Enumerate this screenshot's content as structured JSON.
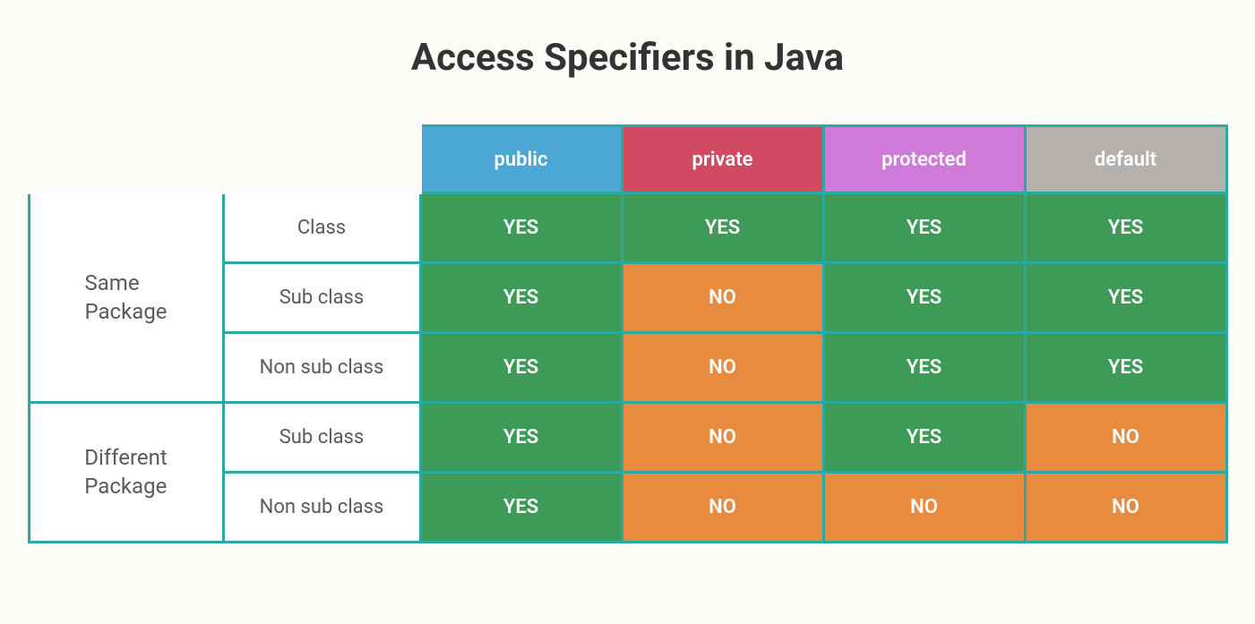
{
  "title": "Access Specifiers in Java",
  "columns": [
    "public",
    "private",
    "protected",
    "default"
  ],
  "groups": [
    {
      "name": "Same\nPackage",
      "rows": [
        {
          "label": "Class",
          "values": [
            "YES",
            "YES",
            "YES",
            "YES"
          ]
        },
        {
          "label": "Sub class",
          "values": [
            "YES",
            "NO",
            "YES",
            "YES"
          ]
        },
        {
          "label": "Non sub class",
          "values": [
            "YES",
            "NO",
            "YES",
            "YES"
          ]
        }
      ]
    },
    {
      "name": "Different\nPackage",
      "rows": [
        {
          "label": "Sub class",
          "values": [
            "YES",
            "NO",
            "YES",
            "NO"
          ]
        },
        {
          "label": "Non sub class",
          "values": [
            "YES",
            "NO",
            "NO",
            "NO"
          ]
        }
      ]
    }
  ],
  "chart_data": {
    "type": "table",
    "title": "Access Specifiers in Java",
    "columns": [
      "public",
      "private",
      "protected",
      "default"
    ],
    "rows": [
      {
        "group": "Same Package",
        "scope": "Class",
        "public": "YES",
        "private": "YES",
        "protected": "YES",
        "default": "YES"
      },
      {
        "group": "Same Package",
        "scope": "Sub class",
        "public": "YES",
        "private": "NO",
        "protected": "YES",
        "default": "YES"
      },
      {
        "group": "Same Package",
        "scope": "Non sub class",
        "public": "YES",
        "private": "NO",
        "protected": "YES",
        "default": "YES"
      },
      {
        "group": "Different Package",
        "scope": "Sub class",
        "public": "YES",
        "private": "NO",
        "protected": "YES",
        "default": "NO"
      },
      {
        "group": "Different Package",
        "scope": "Non sub class",
        "public": "YES",
        "private": "NO",
        "protected": "NO",
        "default": "NO"
      }
    ]
  }
}
